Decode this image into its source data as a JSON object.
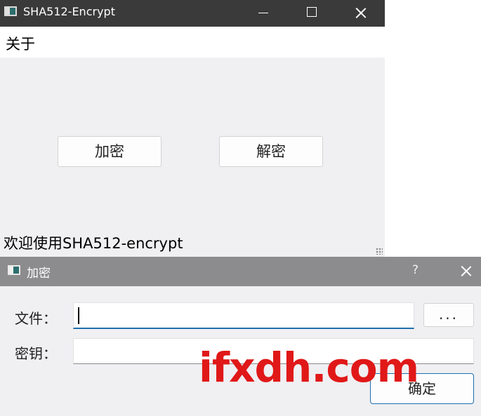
{
  "main_window": {
    "title": "SHA512-Encrypt",
    "menu": {
      "about": "关于"
    },
    "buttons": {
      "encrypt": "加密",
      "decrypt": "解密"
    },
    "status": "欢迎使用SHA512-encrypt"
  },
  "dialog": {
    "title": "加密",
    "help": "?",
    "file_label": "文件：",
    "file_value": "",
    "browse_label": "...",
    "key_label": "密钥：",
    "key_value": "",
    "ok_label": "确定"
  },
  "watermark": {
    "text": "ifxdh.com",
    "color": "#e01818"
  },
  "colors": {
    "accent": "#1f6fae",
    "titlebar": "#3a3a3a",
    "dialog_titlebar": "#8c8b8d"
  }
}
